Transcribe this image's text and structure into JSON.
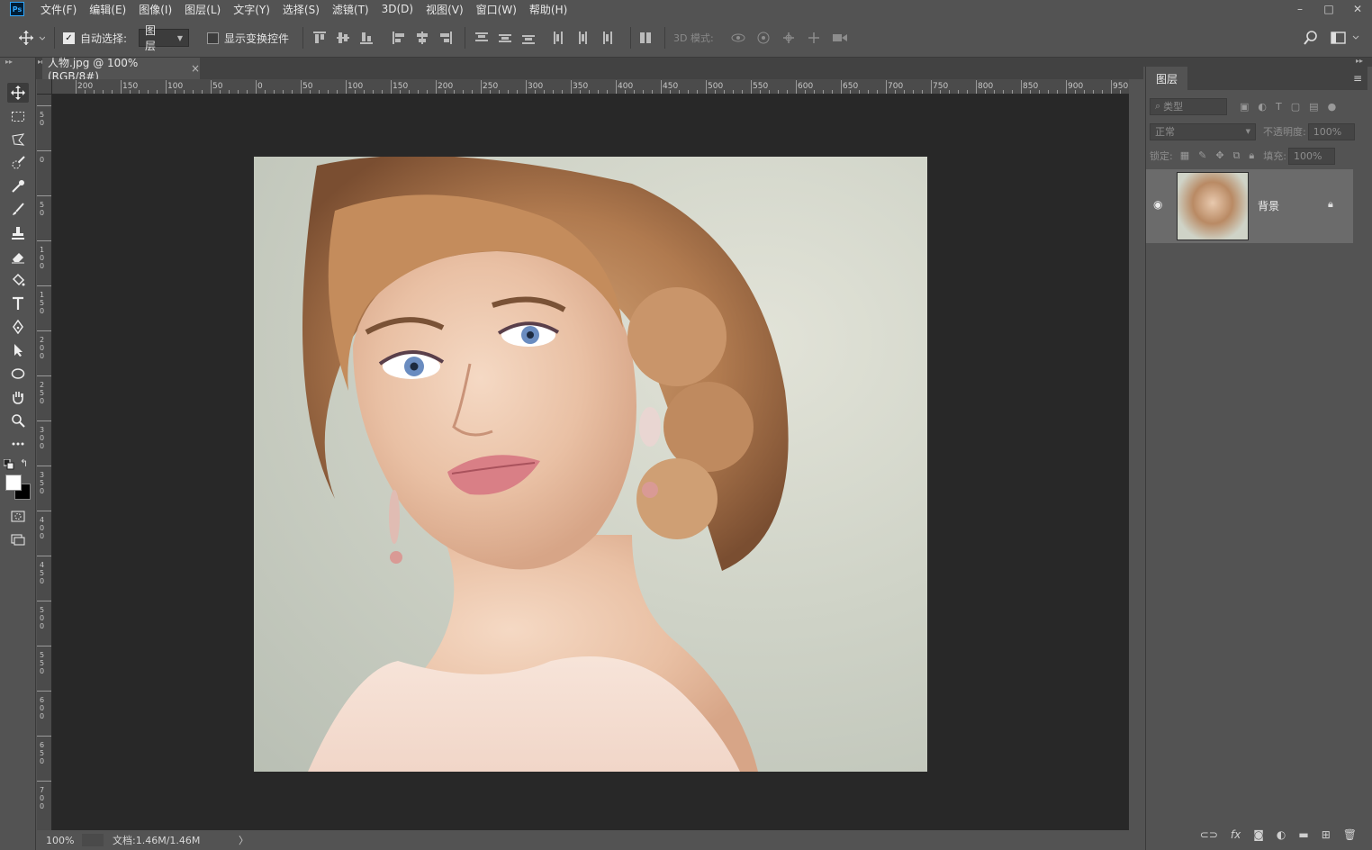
{
  "app": {
    "logo": "Ps"
  },
  "menu": [
    "文件(F)",
    "编辑(E)",
    "图像(I)",
    "图层(L)",
    "文字(Y)",
    "选择(S)",
    "滤镜(T)",
    "3D(D)",
    "视图(V)",
    "窗口(W)",
    "帮助(H)"
  ],
  "window_controls": {
    "minimize": "–",
    "maximize": "□",
    "close": "✕"
  },
  "options": {
    "auto_select_label": "自动选择:",
    "auto_select_checked": true,
    "auto_select_target": "图层",
    "show_transform_label": "显示变换控件",
    "mode_3d_label": "3D 模式:"
  },
  "document": {
    "tab_title": "人物.jpg @ 100%(RGB/8#)",
    "tab_close": "×",
    "zoom": "100%",
    "doc_info": "文档:1.46M/1.46M",
    "status_arrow": "〉"
  },
  "ruler_top_labels": [
    "200",
    "150",
    "100",
    "50",
    "0",
    "50",
    "100",
    "150",
    "200",
    "250",
    "300",
    "350",
    "400",
    "450",
    "500",
    "550",
    "600",
    "650",
    "700",
    "750",
    "800",
    "850",
    "900",
    "950"
  ],
  "ruler_left_labels": [
    "5\n0",
    "0",
    "5\n0",
    "1\n0\n0",
    "1\n5\n0",
    "2\n0\n0",
    "2\n5\n0",
    "3\n0\n0",
    "3\n5\n0",
    "4\n0\n0",
    "4\n5\n0",
    "5\n0\n0",
    "5\n5\n0",
    "6\n0\n0",
    "6\n5\n0",
    "7\n0\n0"
  ],
  "layers_panel": {
    "tab": "图层",
    "menu_icon": "≡",
    "filter_placeholder": "类型",
    "blend_mode": "正常",
    "opacity_label": "不透明度:",
    "opacity_value": "100%",
    "lock_label": "锁定:",
    "fill_label": "填充:",
    "fill_value": "100%",
    "layers": [
      {
        "name": "背景",
        "visible": true,
        "locked": true
      }
    ]
  },
  "footer_icons": [
    "link-icon",
    "fx-icon",
    "mask-icon",
    "adjustment-icon",
    "folder-icon",
    "new-layer-icon",
    "trash-icon"
  ],
  "colors": {
    "accent": "#31a8ff",
    "panel_bg": "#535353",
    "canvas_bg": "#282828"
  }
}
